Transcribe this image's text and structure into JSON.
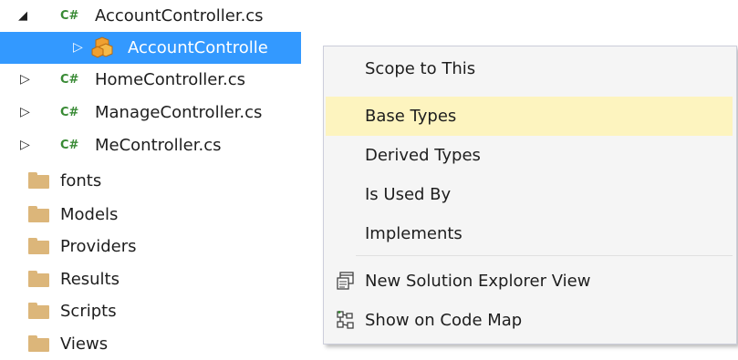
{
  "tree": {
    "items": [
      {
        "label": "AccountController.cs",
        "cs_badge": "C#"
      },
      {
        "label": "AccountControlle"
      },
      {
        "label": "HomeController.cs",
        "cs_badge": "C#"
      },
      {
        "label": "ManageController.cs",
        "cs_badge": "C#"
      },
      {
        "label": "MeController.cs",
        "cs_badge": "C#"
      },
      {
        "label": "fonts"
      },
      {
        "label": "Models"
      },
      {
        "label": "Providers"
      },
      {
        "label": "Results"
      },
      {
        "label": "Scripts"
      },
      {
        "label": "Views"
      }
    ]
  },
  "context_menu": {
    "items": [
      {
        "label": "Scope to This"
      },
      {
        "label": "Base Types"
      },
      {
        "label": "Derived Types"
      },
      {
        "label": "Is Used By"
      },
      {
        "label": "Implements"
      },
      {
        "label": "New Solution Explorer View",
        "icon": "new-view-icon"
      },
      {
        "label": "Show on Code Map",
        "icon": "code-map-icon"
      }
    ]
  },
  "colors": {
    "selection": "#3399ff",
    "menu_highlight": "#fdf4bf",
    "cs_green": "#388a34",
    "folder": "#dcb67a"
  }
}
